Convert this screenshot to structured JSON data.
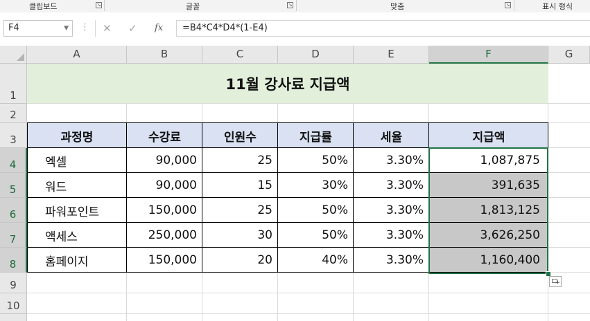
{
  "ribbon": {
    "groups": [
      {
        "label": "클립보드",
        "launcher": "↘"
      },
      {
        "label": "글꼴",
        "launcher": "↘"
      },
      {
        "label": "맞춤",
        "launcher": "↘"
      },
      {
        "label": "표시 형식"
      }
    ]
  },
  "formula_bar": {
    "name_box": "F4",
    "cancel_icon": "✕",
    "enter_icon": "✓",
    "fx_label": "fx",
    "formula": "=B4*C4*D4*(1-E4)"
  },
  "columns": [
    "A",
    "B",
    "C",
    "D",
    "E",
    "F",
    "G"
  ],
  "rows": [
    "1",
    "2",
    "3",
    "4",
    "5",
    "6",
    "7",
    "8",
    "9",
    "10"
  ],
  "sheet": {
    "title": "11월 강사료 지급액",
    "headers": [
      "과정명",
      "수강료",
      "인원수",
      "지급률",
      "세율",
      "지급액"
    ],
    "data": [
      [
        "엑셀",
        "90,000",
        "25",
        "50%",
        "3.30%",
        "1,087,875"
      ],
      [
        "워드",
        "90,000",
        "15",
        "30%",
        "3.30%",
        "391,635"
      ],
      [
        "파워포인트",
        "150,000",
        "25",
        "50%",
        "3.30%",
        "1,813,125"
      ],
      [
        "액세스",
        "250,000",
        "30",
        "50%",
        "3.30%",
        "3,626,250"
      ],
      [
        "홈페이지",
        "150,000",
        "20",
        "40%",
        "3.30%",
        "1,160,400"
      ]
    ]
  },
  "selection": {
    "active_cell": "F4",
    "range": "F4:F8"
  },
  "colors": {
    "selection_green": "#217346",
    "title_fill": "#e2efda",
    "header_fill": "#d9e1f2",
    "selected_fill": "#c8c8c8"
  }
}
